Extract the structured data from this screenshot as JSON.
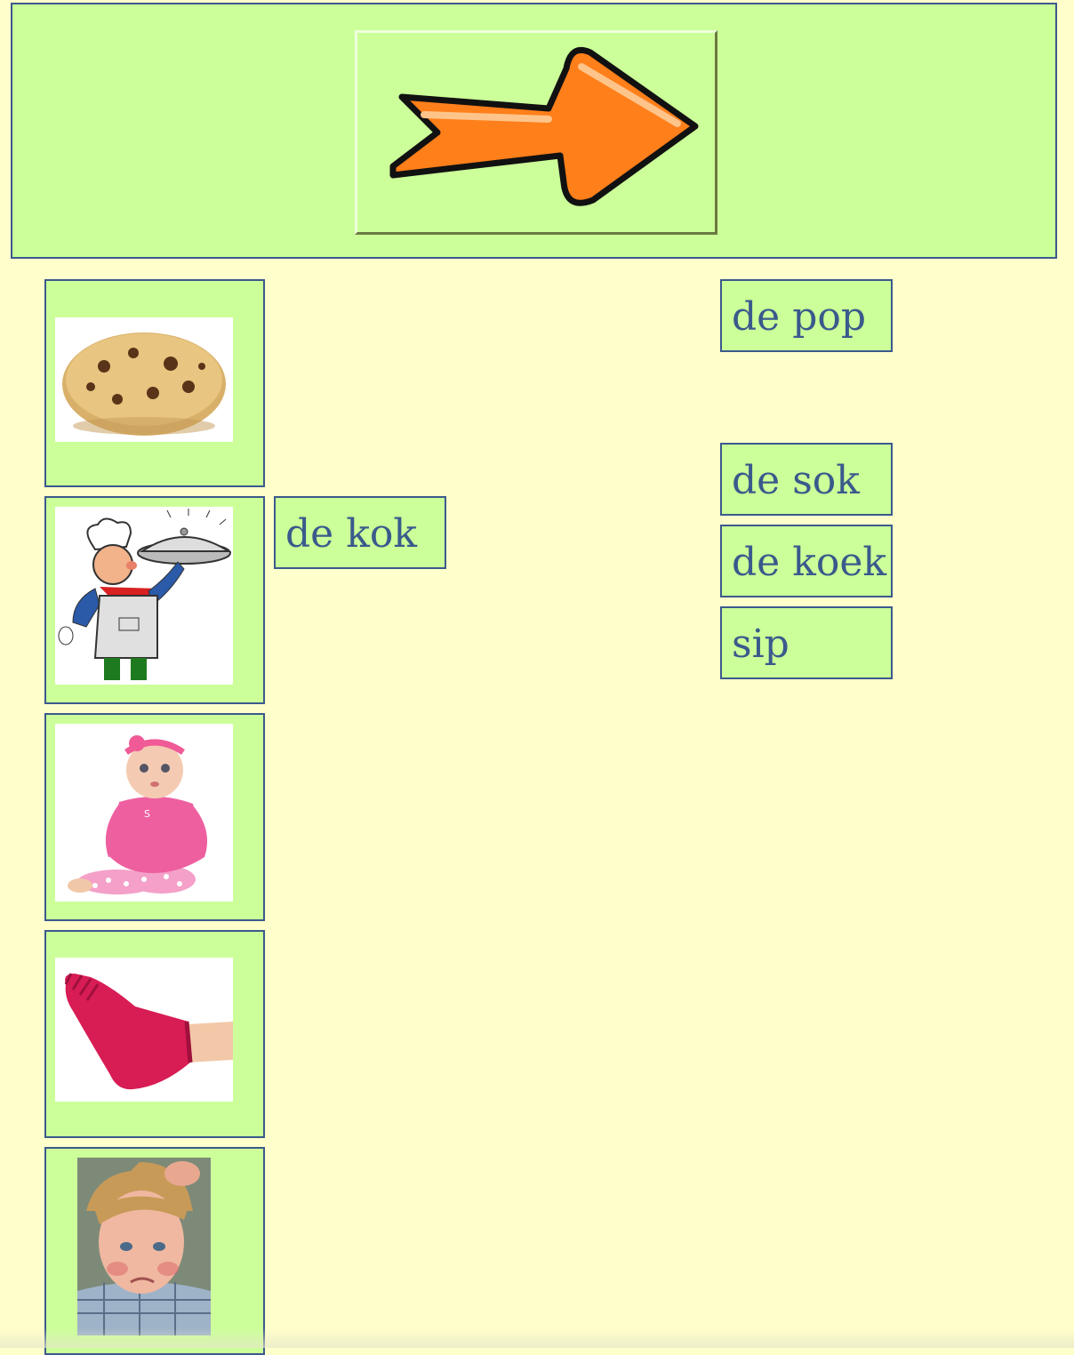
{
  "toolbar": {
    "next_icon": "arrow-right-icon",
    "arrow_color": "#ff7f1a"
  },
  "pictures": [
    {
      "icon": "cookie-image"
    },
    {
      "icon": "chef-image"
    },
    {
      "icon": "doll-image"
    },
    {
      "icon": "sock-image"
    },
    {
      "icon": "sad-boy-image"
    }
  ],
  "placed_words": [
    {
      "label": "de kok"
    }
  ],
  "word_bank": [
    {
      "label": "de pop"
    },
    {
      "label": "de sok"
    },
    {
      "label": "de koek"
    },
    {
      "label": "sip"
    }
  ],
  "colors": {
    "background": "#ffffcc",
    "card": "#ccff99",
    "border": "#3a5a8c",
    "text": "#3a5a8c"
  }
}
